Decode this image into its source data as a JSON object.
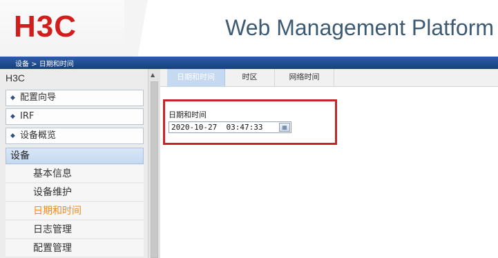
{
  "header": {
    "logo_text": "H3C",
    "title": "Web Management Platform"
  },
  "breadcrumb": "设备 > 日期和时间",
  "sidebar": {
    "root": "H3C",
    "groups": [
      {
        "label": "配置向导"
      },
      {
        "label": "IRF"
      },
      {
        "label": "设备概览"
      }
    ],
    "section": "设备",
    "items": [
      {
        "label": "基本信息",
        "active": false
      },
      {
        "label": "设备维护",
        "active": false
      },
      {
        "label": "日期和时间",
        "active": true
      },
      {
        "label": "日志管理",
        "active": false
      },
      {
        "label": "配置管理",
        "active": false
      }
    ]
  },
  "tabs": [
    {
      "label": "日期和时间",
      "active": true
    },
    {
      "label": "时区",
      "active": false
    },
    {
      "label": "网络时间",
      "active": false
    }
  ],
  "form": {
    "datetime_label": "日期和时间",
    "datetime_value": "2020-10-27  03:47:33",
    "calendar_icon": "calendar-icon"
  },
  "colors": {
    "brand_red": "#d21d1d",
    "nav_bar": "#1f4c8f",
    "active_item": "#f28a1b",
    "highlight": "#c9232a"
  }
}
